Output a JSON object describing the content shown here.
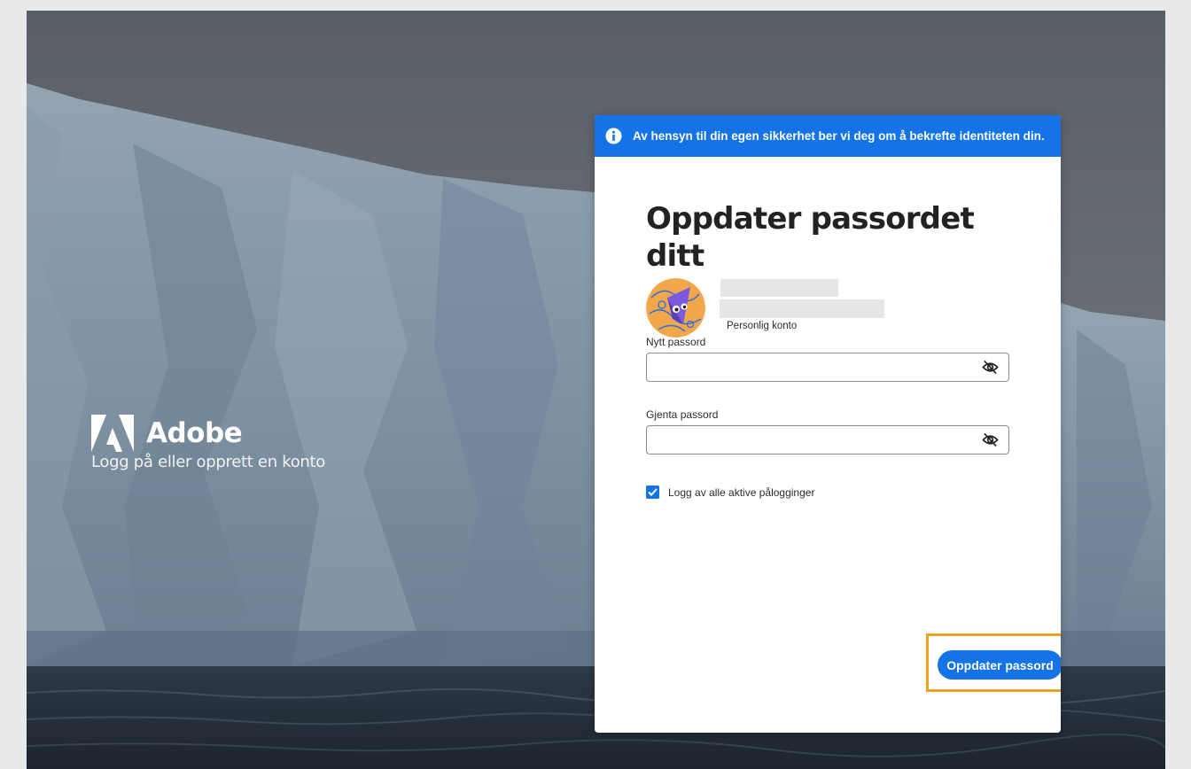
{
  "brand": {
    "name": "Adobe",
    "tagline": "Logg på eller opprett en konto",
    "logo_icon": "adobe-logo-icon"
  },
  "banner": {
    "icon": "info-icon",
    "text": "Av hensyn til din egen sikkerhet ber vi deg om å bekrefte identiteten din.",
    "color": "#1473e6"
  },
  "form": {
    "title": "Oppdater passordet ditt",
    "account": {
      "type_label": "Personlig konto"
    },
    "new_password": {
      "label": "Nytt passord",
      "value": "",
      "toggle_icon": "eye-hidden-icon"
    },
    "repeat_password": {
      "label": "Gjenta passord",
      "value": "",
      "toggle_icon": "eye-hidden-icon"
    },
    "logout_all": {
      "label": "Logg av alle aktive pålogginger",
      "checked": true
    },
    "submit_label": "Oppdater passord"
  },
  "colors": {
    "accent": "#1473e6",
    "highlight": "#f0a020"
  }
}
